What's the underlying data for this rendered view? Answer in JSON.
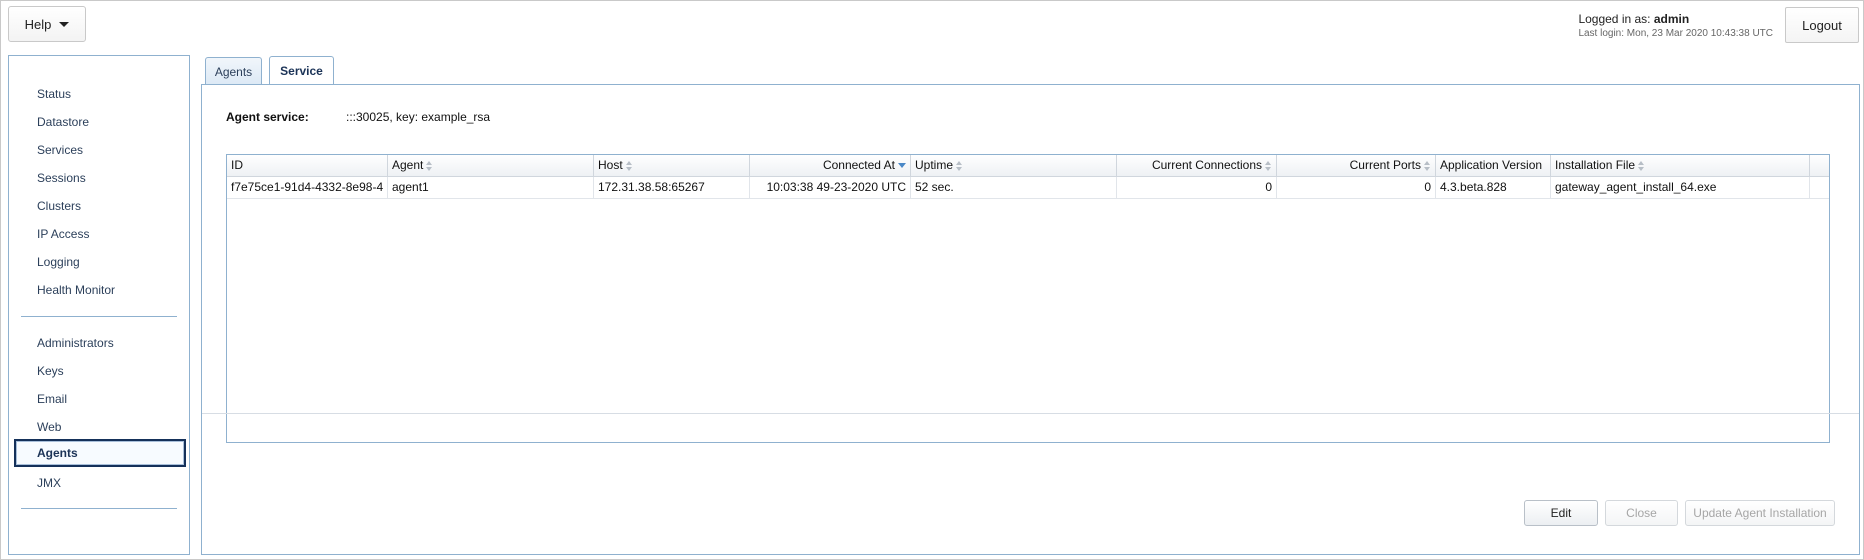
{
  "header": {
    "help_label": "Help",
    "logged_in_prefix": "Logged in as:",
    "username": "admin",
    "last_login": "Last login: Mon, 23 Mar 2020 10:43:38 UTC",
    "logout_label": "Logout"
  },
  "sidebar": {
    "group1": [
      "Status",
      "Datastore",
      "Services",
      "Sessions",
      "Clusters",
      "IP Access",
      "Logging",
      "Health Monitor"
    ],
    "group2": [
      "Administrators",
      "Keys",
      "Email",
      "Web",
      "Agents",
      "JMX"
    ],
    "active": "Agents"
  },
  "tabs": [
    {
      "label": "Agents",
      "active": false
    },
    {
      "label": "Service",
      "active": true
    }
  ],
  "service": {
    "label": "Agent service:",
    "value": ":::30025, key: example_rsa"
  },
  "table": {
    "columns": [
      "ID",
      "Agent",
      "Host",
      "Connected At",
      "Uptime",
      "Current Connections",
      "Current Ports",
      "Application Version",
      "Installation File"
    ],
    "rows": [
      [
        "f7e75ce1-91d4-4332-8e98-4",
        "agent1",
        "172.31.38.58:65267",
        "10:03:38 49-23-2020 UTC",
        "52 sec.",
        "0",
        "0",
        "4.3.beta.828",
        "gateway_agent_install_64.exe"
      ]
    ]
  },
  "buttons": {
    "edit": "Edit",
    "close": "Close",
    "update": "Update Agent Installation"
  }
}
